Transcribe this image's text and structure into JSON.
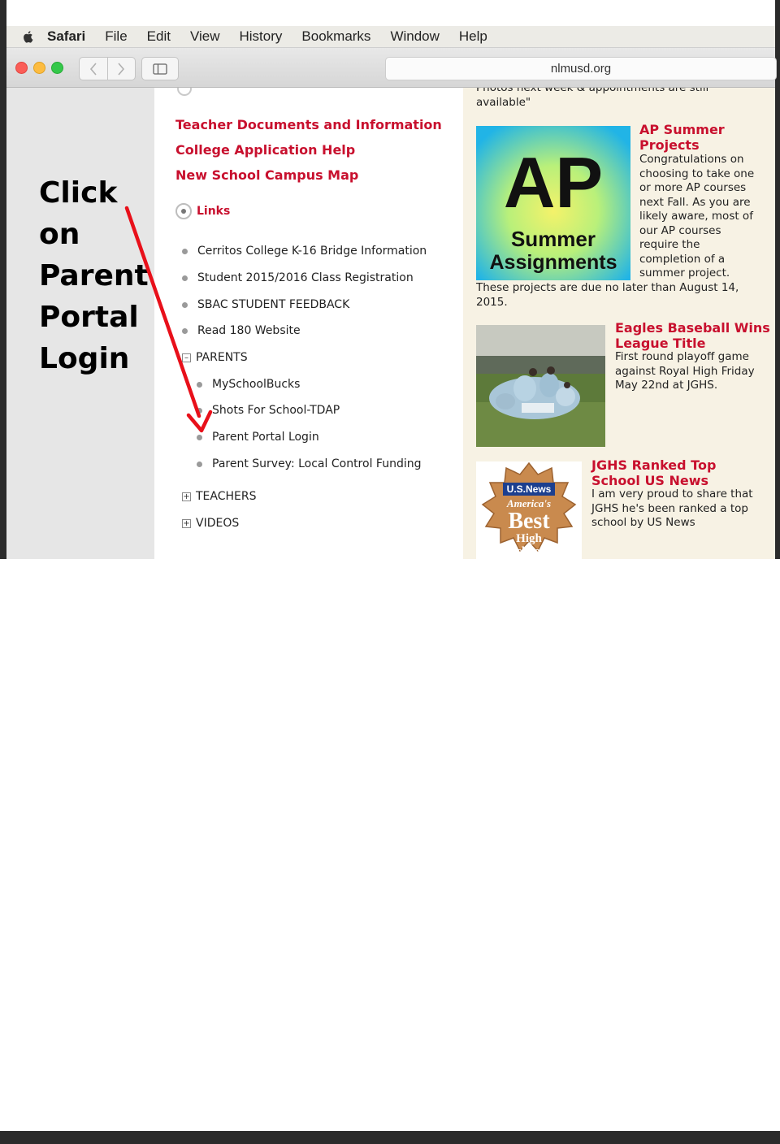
{
  "annotation": {
    "lines": [
      "Click",
      "on",
      "Parent",
      "Portal",
      "Login"
    ]
  },
  "menubar": {
    "app": "Safari",
    "items": [
      "File",
      "Edit",
      "View",
      "History",
      "Bookmarks",
      "Window",
      "Help"
    ]
  },
  "toolbar": {
    "url": "nlmusd.org"
  },
  "page": {
    "partial_top_text": [
      "Photos next week & appointments are still",
      "available\""
    ],
    "top_links": [
      "Teacher Documents and Information",
      "College Application Help",
      "New School Campus Map"
    ],
    "links_header": "Links",
    "links": [
      "Cerritos College K-16 Bridge Information",
      "Student 2015/2016 Class Registration",
      "SBAC STUDENT FEEDBACK",
      "Read 180 Website"
    ],
    "parents": {
      "label": "PARENTS",
      "items": [
        "MySchoolBucks",
        "Shots For School-TDAP",
        "Parent Portal Login",
        "Parent Survey: Local Control Funding"
      ]
    },
    "collapsed": [
      "TEACHERS",
      "VIDEOS"
    ]
  },
  "news": [
    {
      "title_lines": [
        "AP Summer",
        "Projects"
      ],
      "body_lines": [
        "Congratulations on",
        "choosing to take one",
        "or more AP courses",
        "next Fall. As you are",
        "likely aware, most of",
        "our AP courses",
        "require the",
        "completion of a",
        "summer project."
      ],
      "footer_lines": [
        "These projects are due no later than August 14,",
        "2015."
      ],
      "image_text": {
        "big": "AP",
        "sub1": "Summer",
        "sub2": "Assignments"
      }
    },
    {
      "title_lines": [
        "Eagles Baseball Wins",
        "League Title"
      ],
      "body_lines": [
        "First round playoff game",
        "against Royal High Friday",
        "May 22nd at JGHS."
      ]
    },
    {
      "title_lines": [
        "JGHS Ranked Top",
        "School US News"
      ],
      "body_lines": [
        "I am very proud to share that",
        "JGHS he's been ranked a top",
        "school by US News"
      ],
      "image_text": {
        "top": "U.S.News",
        "l1": "America's",
        "l2": "Best",
        "l3": "High",
        "l4": "Schools"
      }
    }
  ],
  "colors": {
    "link_red": "#c8102e",
    "arrow_red": "#e8101a",
    "news_bg": "#f7f2e4"
  }
}
